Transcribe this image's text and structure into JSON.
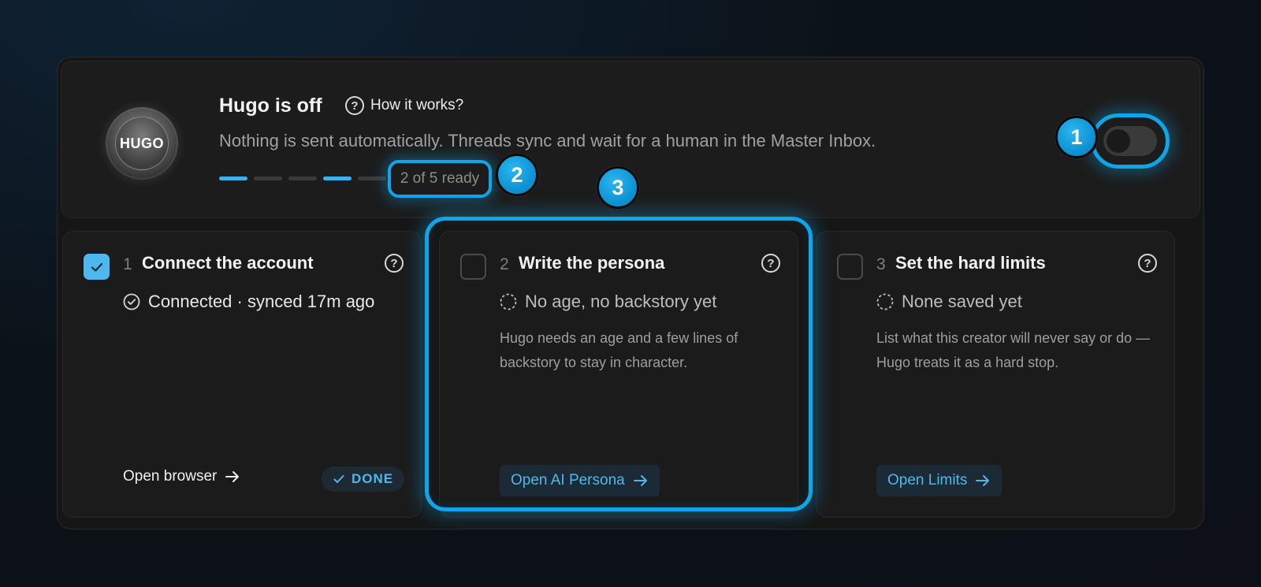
{
  "header": {
    "logo_text": "HUGO",
    "title": "Hugo is off",
    "how_it_works": "How it works?",
    "subtitle": "Nothing is sent automatically. Threads sync and wait for a human in the Master Inbox.",
    "progress": {
      "completed": 2,
      "total": 5,
      "segments": [
        true,
        false,
        false,
        true,
        false
      ],
      "label": "2 of 5 ready"
    },
    "toggle_on": false
  },
  "badges": {
    "b1": "1",
    "b2": "2",
    "b3": "3"
  },
  "cards": [
    {
      "number": "1",
      "title": "Connect the account",
      "checked": true,
      "status": "Connected · synced 17m ago",
      "description": "",
      "action": "Open browser",
      "done_label": "DONE"
    },
    {
      "number": "2",
      "title": "Write the persona",
      "checked": false,
      "status": "No age, no backstory yet",
      "description": "Hugo needs an age and a few lines of backstory to stay in character.",
      "action": "Open AI Persona"
    },
    {
      "number": "3",
      "title": "Set the hard limits",
      "checked": false,
      "status": "None saved yet",
      "description": "List what this creator will never say or do — Hugo treats it as a hard stop.",
      "action": "Open Limits"
    }
  ],
  "colors": {
    "accent": "#0ea5e9",
    "link": "#4eb8ee",
    "background": "#161616"
  }
}
